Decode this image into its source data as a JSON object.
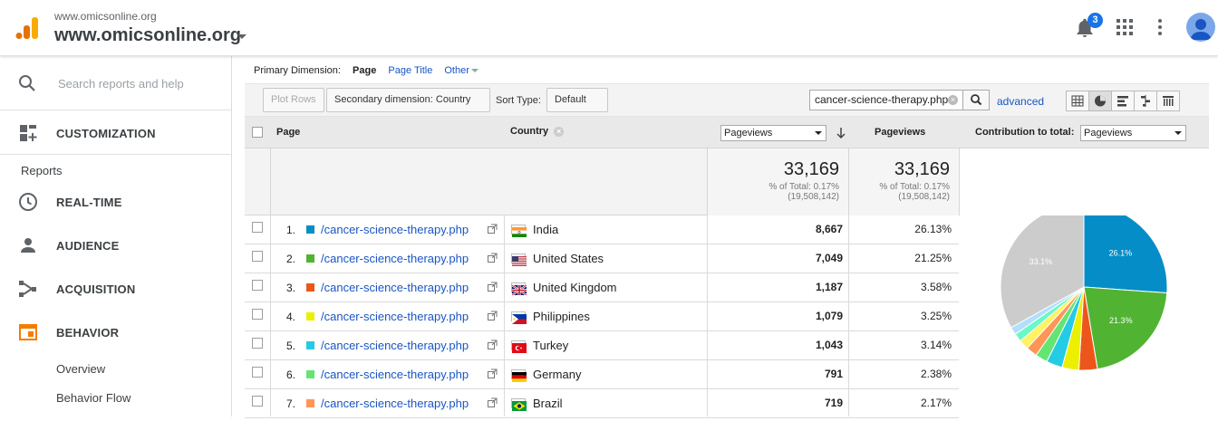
{
  "header": {
    "site_small": "www.omicsonline.org",
    "site_big": "www.omicsonline.org",
    "notifications_count": "3"
  },
  "sidebar": {
    "search_placeholder": "Search reports and help",
    "customization_label": "CUSTOMIZATION",
    "reports_label": "Reports",
    "items": [
      {
        "label": "REAL-TIME",
        "icon": "clock-icon"
      },
      {
        "label": "AUDIENCE",
        "icon": "person-icon"
      },
      {
        "label": "ACQUISITION",
        "icon": "acquisition-icon"
      },
      {
        "label": "BEHAVIOR",
        "icon": "behavior-icon"
      }
    ],
    "sub_items": [
      "Overview",
      "Behavior Flow"
    ],
    "accent_color": "#f57c00"
  },
  "dimension_bar": {
    "label": "Primary Dimension:",
    "active": "Page",
    "options": [
      "Page Title",
      "Other"
    ]
  },
  "toolbar": {
    "plot_rows": "Plot Rows",
    "secondary_dimension": "Secondary dimension: Country",
    "sort_type_label": "Sort Type:",
    "sort_type_value": "Default",
    "filter_value": "cancer-science-therapy.php",
    "advanced_label": "advanced"
  },
  "table": {
    "headers": {
      "page": "Page",
      "country": "Country",
      "metric_select": "Pageviews",
      "pageviews": "Pageviews",
      "contribution_label": "Contribution to total:",
      "contribution_select": "Pageviews"
    },
    "totals": {
      "value1": "33,169",
      "pct1": "% of Total: 0.17%",
      "total1": "(19,508,142)",
      "value2": "33,169",
      "pct2": "% of Total: 0.17%",
      "total2": "(19,508,142)"
    },
    "rows": [
      {
        "idx": "1.",
        "page": "/cancer-science-therapy.php",
        "country": "India",
        "flag": "india",
        "pageviews": "8,667",
        "percent": "26.13%",
        "color": "#058dc7"
      },
      {
        "idx": "2.",
        "page": "/cancer-science-therapy.php",
        "country": "United States",
        "flag": "us",
        "pageviews": "7,049",
        "percent": "21.25%",
        "color": "#50b432"
      },
      {
        "idx": "3.",
        "page": "/cancer-science-therapy.php",
        "country": "United Kingdom",
        "flag": "uk",
        "pageviews": "1,187",
        "percent": "3.58%",
        "color": "#ed561b"
      },
      {
        "idx": "4.",
        "page": "/cancer-science-therapy.php",
        "country": "Philippines",
        "flag": "ph",
        "pageviews": "1,079",
        "percent": "3.25%",
        "color": "#edef00"
      },
      {
        "idx": "5.",
        "page": "/cancer-science-therapy.php",
        "country": "Turkey",
        "flag": "tr",
        "pageviews": "1,043",
        "percent": "3.14%",
        "color": "#24cbe5"
      },
      {
        "idx": "6.",
        "page": "/cancer-science-therapy.php",
        "country": "Germany",
        "flag": "de",
        "pageviews": "791",
        "percent": "2.38%",
        "color": "#64e572"
      },
      {
        "idx": "7.",
        "page": "/cancer-science-therapy.php",
        "country": "Brazil",
        "flag": "br",
        "pageviews": "719",
        "percent": "2.17%",
        "color": "#ff9655"
      }
    ]
  },
  "pie": {
    "slices": [
      {
        "value": 26.13,
        "color": "#058dc7",
        "label": "26.1%"
      },
      {
        "value": 21.25,
        "color": "#50b432",
        "label": "21.3%"
      },
      {
        "value": 3.58,
        "color": "#ed561b",
        "label": ""
      },
      {
        "value": 3.25,
        "color": "#edef00",
        "label": ""
      },
      {
        "value": 3.14,
        "color": "#24cbe5",
        "label": ""
      },
      {
        "value": 2.38,
        "color": "#64e572",
        "label": ""
      },
      {
        "value": 2.17,
        "color": "#ff9655",
        "label": ""
      },
      {
        "value": 1.9,
        "color": "#fff263",
        "label": ""
      },
      {
        "value": 1.6,
        "color": "#6af9c4",
        "label": ""
      },
      {
        "value": 1.5,
        "color": "#b2deff",
        "label": ""
      },
      {
        "value": 33.1,
        "color": "#cccccc",
        "label": "33.1%"
      }
    ]
  }
}
